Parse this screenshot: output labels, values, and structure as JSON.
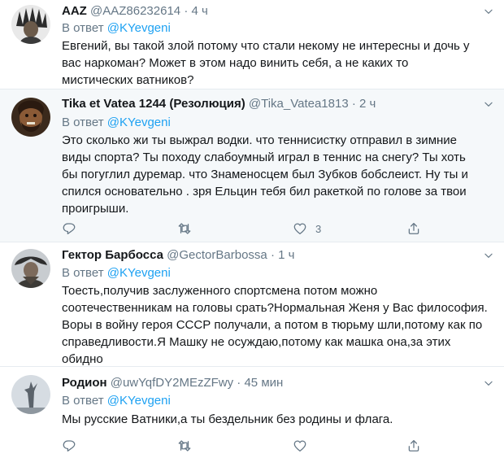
{
  "tweets": [
    {
      "name": "AAZ",
      "handle": "@AAZ86232614",
      "dot": "·",
      "time": "4 ч",
      "reply_prefix": "В ответ",
      "reply_to": "@KYevgeni",
      "text_lines": [
        "Евгений, вы такой злой потому что стали некому не интересны и дочь у",
        "вас наркоман? Может в этом надо винить себя, а не каких то",
        "мистических ватников?"
      ]
    },
    {
      "name": "Tika et Vatea 1244 (Резолюция)",
      "handle": "@Tika_Vatea1813",
      "dot": "·",
      "time": "2 ч",
      "reply_prefix": "В ответ",
      "reply_to": "@KYevgeni",
      "text_lines": [
        "Это сколько жи ты выжрал водки. что теннисистку отправил в зимние",
        "виды спорта? Ты походу слабоумный играл в теннис на снегу? Ты хоть",
        "бы погуглил дуремар. что Знаменосцем был Зубков бобслеист. Ну ты и",
        "спился основательно . зря Ельцин тебя бил ракеткой по голове за твои",
        "проигрыши."
      ],
      "like_count": "3"
    },
    {
      "name": "Гектор Барбосса",
      "handle": "@GectorBarbossa",
      "dot": "·",
      "time": "1 ч",
      "reply_prefix": "В ответ",
      "reply_to": "@KYevgeni",
      "text_lines": [
        "Тоесть,получив заслуженного спортсмена потом можно",
        "соотечественникам на головы срать?Нормальная Женя у Вас философия.",
        "Воры в войну героя СССР получали, а потом в тюрьму шли,потому как по",
        "справедливости.Я Машку не осуждаю,потому как машка она,за этих",
        "обидно"
      ]
    },
    {
      "name": "Родион",
      "handle": "@uwYqfDY2MEzZFwy",
      "dot": "·",
      "time": "45 мин",
      "reply_prefix": "В ответ",
      "reply_to": "@KYevgeni",
      "text_lines": [
        "Мы русские Ватники,а ты бездельник без родины и флага."
      ]
    }
  ],
  "icons": {
    "reply": "reply-icon",
    "retweet": "retweet-icon",
    "like": "heart-icon",
    "share": "share-icon",
    "menu": "chevron-down-icon"
  },
  "colors": {
    "text": "#14171a",
    "secondary": "#657786",
    "link": "#1da1f2",
    "divider": "#e6ecf0",
    "highlight_bg": "#f5f8fa"
  }
}
